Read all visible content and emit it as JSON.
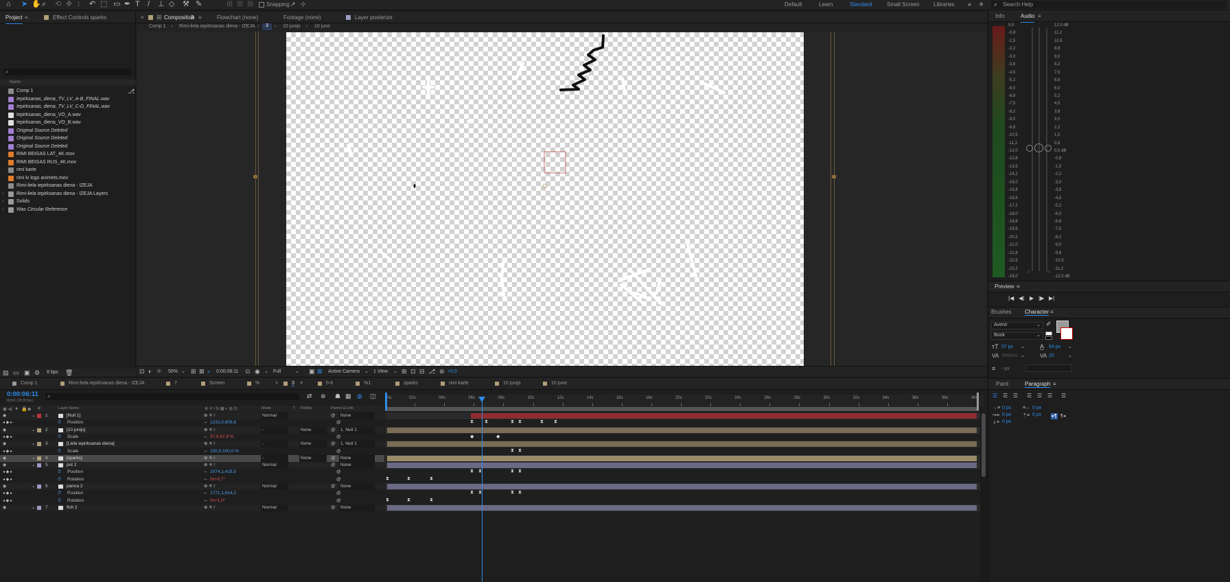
{
  "toolbar": {
    "snapping_label": "Snapping",
    "workspaces": [
      "Default",
      "Learn",
      "Standard",
      "Small Screen",
      "Libraries"
    ],
    "active_workspace": "Standard",
    "search_help": "Search Help"
  },
  "project_panel": {
    "tab_project": "Project",
    "tab_effect_controls": "Effect Controls sparks",
    "search_placeholder": "",
    "name_header": "Name",
    "items": [
      {
        "label": "Comp 1",
        "icon": "composition-icon",
        "italic": false,
        "color": "#8a8a8a"
      },
      {
        "label": "Iepirksanas_diena_TV_LV_A-B_FINAL.wav",
        "icon": "audio-file-icon",
        "italic": true,
        "color": "#a07fd0"
      },
      {
        "label": "Iepirksanas_diena_TV_LV_C-D_FINAL.wav",
        "icon": "audio-file-icon",
        "italic": true,
        "color": "#a07fd0"
      },
      {
        "label": "Iepirksanas_diena_VO_A.wav",
        "icon": "audio-file-icon",
        "italic": false,
        "color": "#e0e0e0"
      },
      {
        "label": "Iepirksanas_diena_VO_B.wav",
        "icon": "audio-file-icon",
        "italic": false,
        "color": "#e0e0e0"
      },
      {
        "label": "Original Source Deleted",
        "icon": "missing-file-icon",
        "italic": true,
        "color": "#a07fd0"
      },
      {
        "label": "Original Source Deleted",
        "icon": "missing-file-icon",
        "italic": true,
        "color": "#a07fd0"
      },
      {
        "label": "Original Source Deleted",
        "icon": "missing-file-icon",
        "italic": true,
        "color": "#a07fd0"
      },
      {
        "label": "RIMI BEIGAS LAT_4K.mov",
        "icon": "video-file-icon",
        "italic": false,
        "color": "#e07c2a"
      },
      {
        "label": "RIMI BEIGAS RUS_4K.mov",
        "icon": "video-file-icon",
        "italic": false,
        "color": "#e07c2a"
      },
      {
        "label": "rimi karte",
        "icon": "composition-icon",
        "italic": false,
        "color": "#8a8a8a"
      },
      {
        "label": "rimi lv logo animets.mov",
        "icon": "video-file-icon",
        "italic": false,
        "color": "#e07c2a"
      },
      {
        "label": "Rimi-liela iepirksanas diena - IZEJA",
        "icon": "composition-icon",
        "italic": false,
        "color": "#8a8a8a"
      },
      {
        "label": "Rimi-liela iepirksanas diena - IZEJA Layers",
        "icon": "folder-icon",
        "italic": false,
        "color": "#9a9a9a"
      },
      {
        "label": "Solids",
        "icon": "folder-icon",
        "italic": false,
        "color": "#9a9a9a"
      },
      {
        "label": "Was Circular Reference",
        "icon": "folder-icon",
        "italic": true,
        "color": "#9a9a9a"
      }
    ],
    "bpc": "8 bpc"
  },
  "composition_panel": {
    "tab_composition": "Composition",
    "tab_composition_suffix": "3",
    "tab_flowchart": "Flowchart (none)",
    "tab_footage": "Footage (none)",
    "tab_layer": "Layer posterize",
    "breadcrumbs": [
      "Comp 1",
      "Rimi-liela iepirksanas diena - IZEJA",
      "3",
      "10 junijs",
      "10 june"
    ],
    "zoom": "50%",
    "timecode": "0:00:06:11",
    "resolution": "Full",
    "camera": "Active Camera",
    "views": "1 View",
    "exposure": "+0,0"
  },
  "right_panel": {
    "tab_info": "Info",
    "tab_audio": "Audio",
    "db_left": [
      "0,0",
      "-0,8",
      "-1,5",
      "-2,2",
      "-3,0",
      "-3,8",
      "-4,5",
      "-5,2",
      "-6,0",
      "-6,8",
      "-7,5",
      "-8,2",
      "-9,0",
      "-9,8",
      "-10,5",
      "-11,2",
      "-12,0",
      "-12,8",
      "-13,5",
      "-14,2",
      "-15,0",
      "-15,8",
      "-16,5",
      "-17,2",
      "-18,0",
      "-18,8",
      "-19,5",
      "-20,2",
      "-21,0",
      "-21,8",
      "-22,5",
      "-23,2",
      "-24,0"
    ],
    "db_right": [
      "12,0 dB",
      "11,2",
      "10,5",
      "9,8",
      "9,0",
      "8,2",
      "7,5",
      "6,8",
      "6,0",
      "5,2",
      "4,5",
      "3,8",
      "3,0",
      "2,2",
      "1,5",
      "0,8",
      "0,0 dB",
      "-0,8",
      "-1,5",
      "-2,2",
      "-3,0",
      "-3,8",
      "-4,5",
      "-5,2",
      "-6,0",
      "-6,8",
      "-7,5",
      "-8,2",
      "-9,0",
      "-9,8",
      "-10,5",
      "-11,2",
      "-12,0 dB"
    ],
    "meter_bottom": [
      "0",
      "0"
    ],
    "preview_label": "Preview",
    "tab_brushes": "Brushes",
    "tab_character": "Character",
    "font": "Avenir",
    "style": "Book",
    "font_size": "57 px",
    "leading": "64 px",
    "kerning": "Metrics",
    "tracking": "20",
    "stroke_unit": "- px",
    "tab_paint": "Paint",
    "tab_paragraph": "Paragraph",
    "para_values": [
      "0 px",
      "0 px",
      "0 px",
      "0 px",
      "0 px"
    ]
  },
  "timeline": {
    "tabs": [
      "Comp 1",
      "Rimi-liela iepirksanas diena - IZEJA",
      "7",
      "Screen",
      "%",
      "3",
      "5-6",
      "%1",
      "sparks",
      "rimi karte",
      "10 junijs",
      "10 june"
    ],
    "active_tab": "3",
    "timecode": "0:00:06:11",
    "timecode_sub": "00161 (25.00 fps)",
    "ruler": [
      "00s",
      "02s",
      "04s",
      "06s",
      "08s",
      "10s",
      "12s",
      "14s",
      "16s",
      "18s",
      "20s",
      "22s",
      "24s",
      "26s",
      "28s",
      "30s",
      "32s",
      "34s",
      "36s",
      "38s",
      "40s"
    ],
    "headers": {
      "layer_name": "Layer Name",
      "mode": "Mode",
      "t": "T",
      "trkmat": "TrkMat",
      "parent": "Parent & Link"
    },
    "rows": [
      {
        "type": "layer",
        "num": "1",
        "name": "[Null 1]",
        "color": "#c0363a",
        "mode": "Normal",
        "trk": "",
        "parent": "None"
      },
      {
        "type": "prop",
        "name": "Position",
        "value": "1233,0,809,6"
      },
      {
        "type": "layer",
        "num": "2",
        "name": "[10 junijs]",
        "color": "#b19e7a",
        "mode": "-",
        "trk": "None",
        "parent": "1. Null 1"
      },
      {
        "type": "prop",
        "name": "Scale",
        "value": "97,9,97,9 %"
      },
      {
        "type": "layer",
        "num": "3",
        "name": "[Liela iepirksanas diena]",
        "color": "#b19e7a",
        "mode": "-",
        "trk": "None",
        "parent": "1. Null 1"
      },
      {
        "type": "prop",
        "name": "Scale",
        "value": "100,0,100,0 %"
      },
      {
        "type": "layer",
        "num": "4",
        "name": "[sparks]",
        "color": "#b19e7a",
        "mode": "-",
        "trk": "None",
        "parent": "None"
      },
      {
        "type": "layer",
        "num": "5",
        "name": "pot 2",
        "color": "#9c9cc2",
        "mode": "Normal",
        "trk": "",
        "parent": "None"
      },
      {
        "type": "prop",
        "name": "Position",
        "value": "2074,1,419,5"
      },
      {
        "type": "prop",
        "name": "Rotation",
        "value": "0x+0,7°"
      },
      {
        "type": "layer",
        "num": "6",
        "name": "panna 2",
        "color": "#9c9cc2",
        "mode": "Normal",
        "trk": "",
        "parent": "None"
      },
      {
        "type": "prop",
        "name": "Position",
        "value": "1771,1,614,2"
      },
      {
        "type": "prop",
        "name": "Rotation",
        "value": "0x+1,0°"
      },
      {
        "type": "layer",
        "num": "7",
        "name": "fish 2",
        "color": "#9c9cc2",
        "mode": "Normal",
        "trk": "",
        "parent": "None"
      }
    ]
  }
}
